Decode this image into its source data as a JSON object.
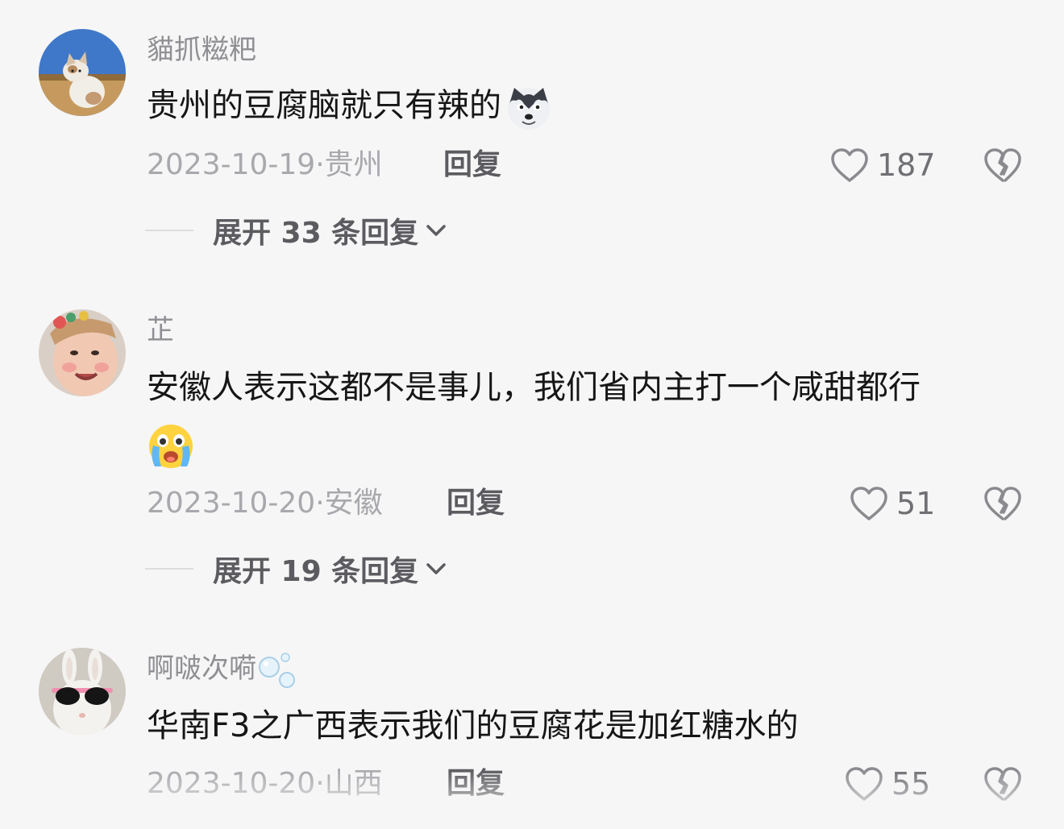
{
  "comments": [
    {
      "username": "貓抓糍粑",
      "avatar_icon": "kitten-avatar",
      "text": "贵州的豆腐脑就只有辣的",
      "emoji": "husky-emoji",
      "date": "2023-10-19",
      "location": "贵州",
      "reply_label": "回复",
      "likes": "187",
      "expand_label": "展开 33 条回复"
    },
    {
      "username": "芷",
      "avatar_icon": "child-face-avatar",
      "text": "安徽人表示这都不是事儿，我们省内主打一个咸甜都行",
      "emoji": "crying-face-emoji",
      "date": "2023-10-20",
      "location": "安徽",
      "reply_label": "回复",
      "likes": "51",
      "expand_label": "展开 19 条回复"
    },
    {
      "username": "啊啵次嗬",
      "username_decoration": "bubbles-icon",
      "avatar_icon": "rabbit-sunglasses-avatar",
      "text": "华南F3之广西表示我们的豆腐花是加红糖水的",
      "date": "2023-10-20",
      "location": "山西",
      "reply_label": "回复",
      "likes": "55"
    }
  ],
  "colors": {
    "background": "#f6f6f6",
    "username": "#8f8f94",
    "meta": "#a8a8ad",
    "action": "#5b5b60"
  }
}
